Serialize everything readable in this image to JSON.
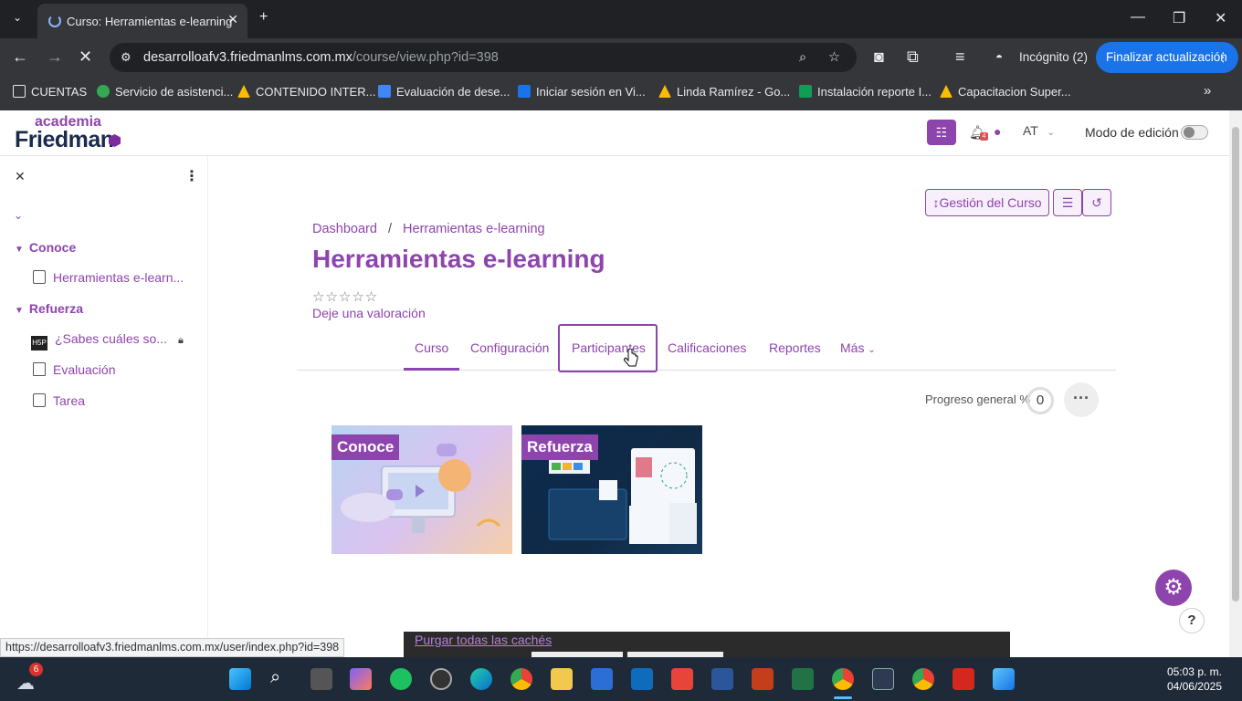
{
  "browser": {
    "tab_title": "Curso: Herramientas e-learning",
    "url_host": "desarrolloafv3.friedmanlms.com.mx",
    "url_path": "/course/view.php?id=398",
    "incognito": "Incógnito (2)",
    "update_button": "Finalizar actualización",
    "bookmarks": [
      {
        "label": "CUENTAS",
        "color": "#e8eaed"
      },
      {
        "label": "Servicio de asistenci...",
        "color": "#34a853"
      },
      {
        "label": "CONTENIDO INTER...",
        "color": "#fbbc04"
      },
      {
        "label": "Evaluación de dese...",
        "color": "#4285f4"
      },
      {
        "label": "Iniciar sesión en Vi...",
        "color": "#1a73e8"
      },
      {
        "label": "Linda Ramírez - Go...",
        "color": "#fbbc04"
      },
      {
        "label": "Instalación reporte I...",
        "color": "#0f9d58"
      },
      {
        "label": "Capacitacion Super...",
        "color": "#fbbc04"
      }
    ],
    "status_url": "https://desarrolloafv3.friedmanlms.com.mx/user/index.php?id=398"
  },
  "header": {
    "logo_top": "academia",
    "logo_main": "Friedman",
    "avatar_initials": "AT",
    "edit_mode_label": "Modo de edición",
    "notification_count": "4"
  },
  "sidebar": {
    "sections": [
      {
        "label": "Conoce",
        "items": [
          {
            "label": "Herramientas e-learn..."
          }
        ]
      },
      {
        "label": "Refuerza",
        "items": [
          {
            "label": "¿Sabes cuáles so..."
          },
          {
            "label": "Evaluación"
          },
          {
            "label": "Tarea"
          }
        ]
      }
    ]
  },
  "main": {
    "breadcrumb": [
      "Dashboard",
      "Herramientas e-learning"
    ],
    "title": "Herramientas e-learning",
    "rating_prompt": "Deje una valoración",
    "manage_button": "Gestión del Curso",
    "tabs": [
      "Curso",
      "Configuración",
      "Participantes",
      "Calificaciones",
      "Reportes",
      "Más"
    ],
    "progress_label": "Progreso general %",
    "progress_value": "0",
    "sections": [
      {
        "label": "Conoce"
      },
      {
        "label": "Refuerza"
      }
    ],
    "purge_link": "Purgar todas las cachés"
  },
  "taskbar": {
    "weather_badge": "6",
    "time": "05:03 p. m.",
    "date": "04/06/2025"
  },
  "colors": {
    "brand": "#8e44ad",
    "browser_dark": "#202124"
  }
}
